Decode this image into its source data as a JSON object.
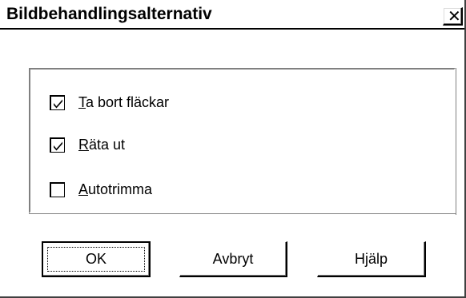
{
  "window": {
    "title": "Bildbehandlingsalternativ",
    "close_glyph": "✕"
  },
  "options": [
    {
      "label_mnemonic": "T",
      "label_rest": "a bort fläckar",
      "checked": true
    },
    {
      "label_mnemonic": "R",
      "label_rest": "äta ut",
      "checked": true
    },
    {
      "label_mnemonic": "A",
      "label_rest": "utotrimma",
      "checked": false
    }
  ],
  "buttons": {
    "ok": "OK",
    "cancel": "Avbryt",
    "help": "Hjälp"
  },
  "colors": {
    "face": "#ffffff",
    "shadow": "#808080",
    "dark": "#000000"
  }
}
